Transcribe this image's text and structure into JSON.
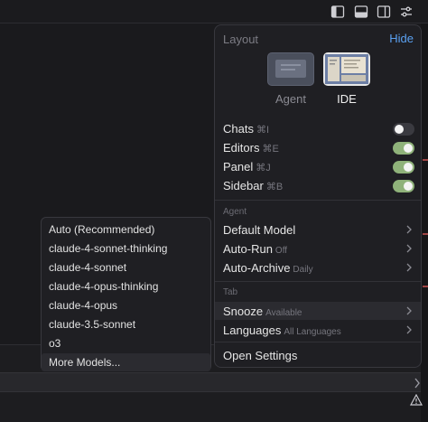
{
  "toolbar": {
    "icons": [
      "sidebar-left-icon",
      "panel-bottom-icon",
      "sidebar-right-icon",
      "sliders-icon"
    ]
  },
  "layout_panel": {
    "title": "Layout",
    "hide_label": "Hide",
    "options": [
      {
        "label": "Agent",
        "selected": false
      },
      {
        "label": "IDE",
        "selected": true
      }
    ],
    "toggles": [
      {
        "label": "Chats",
        "shortcut": "⌘I",
        "on": false
      },
      {
        "label": "Editors",
        "shortcut": "⌘E",
        "on": true
      },
      {
        "label": "Panel",
        "shortcut": "⌘J",
        "on": true
      },
      {
        "label": "Sidebar",
        "shortcut": "⌘B",
        "on": true
      }
    ],
    "agent_section": "Agent",
    "agent_items": [
      {
        "label": "Default Model",
        "value": ""
      },
      {
        "label": "Auto-Run",
        "value": "Off"
      },
      {
        "label": "Auto-Archive",
        "value": "Daily"
      }
    ],
    "tab_section": "Tab",
    "tab_items": [
      {
        "label": "Snooze",
        "value": "Available"
      },
      {
        "label": "Languages",
        "value": "All Languages"
      }
    ],
    "settings_label": "Open Settings"
  },
  "models": {
    "items": [
      "Auto (Recommended)",
      "claude-4-sonnet-thinking",
      "claude-4-sonnet",
      "claude-4-opus-thinking",
      "claude-4-opus",
      "claude-3.5-sonnet",
      "o3",
      "More Models..."
    ],
    "highlighted": "More Models..."
  },
  "colors": {
    "accent": "#5aa0f0",
    "toggle_on": "#8fb27a",
    "background": "#1a1a1d"
  }
}
